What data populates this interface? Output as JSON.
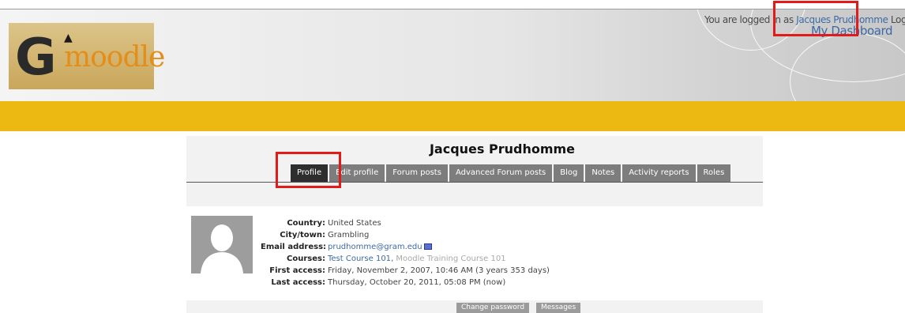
{
  "header": {
    "logo_alt": "G moodle",
    "login_prefix": "You are logged in as",
    "user_name": "Jacques Prudhomme",
    "logout_label": "Logout",
    "dashboard_label": "My Dashboard",
    "bar_color": "#ecb912"
  },
  "profile": {
    "title": "Jacques Prudhomme",
    "tabs": [
      {
        "label": "Profile",
        "active": true
      },
      {
        "label": "Edit profile",
        "active": false
      },
      {
        "label": "Forum posts",
        "active": false
      },
      {
        "label": "Advanced Forum posts",
        "active": false
      },
      {
        "label": "Blog",
        "active": false
      },
      {
        "label": "Notes",
        "active": false
      },
      {
        "label": "Activity reports",
        "active": false
      },
      {
        "label": "Roles",
        "active": false
      }
    ],
    "fields": {
      "country_label": "Country:",
      "country": "United States",
      "city_label": "City/town:",
      "city": "Grambling",
      "email_label": "Email address:",
      "email": "prudhomme@gram.edu",
      "courses_label": "Courses:",
      "course_1": "Test Course 101",
      "course_2": "Moodle Training Course 101",
      "first_access_label": "First access:",
      "first_access": "Friday, November 2, 2007, 10:46 AM  (3 years 353 days)",
      "last_access_label": "Last access:",
      "last_access": "Thursday, October 20, 2011, 05:08 PM  (now)"
    },
    "buttons": {
      "change_password": "Change password",
      "messages": "Messages"
    }
  },
  "highlight_color": "#e21a1a"
}
